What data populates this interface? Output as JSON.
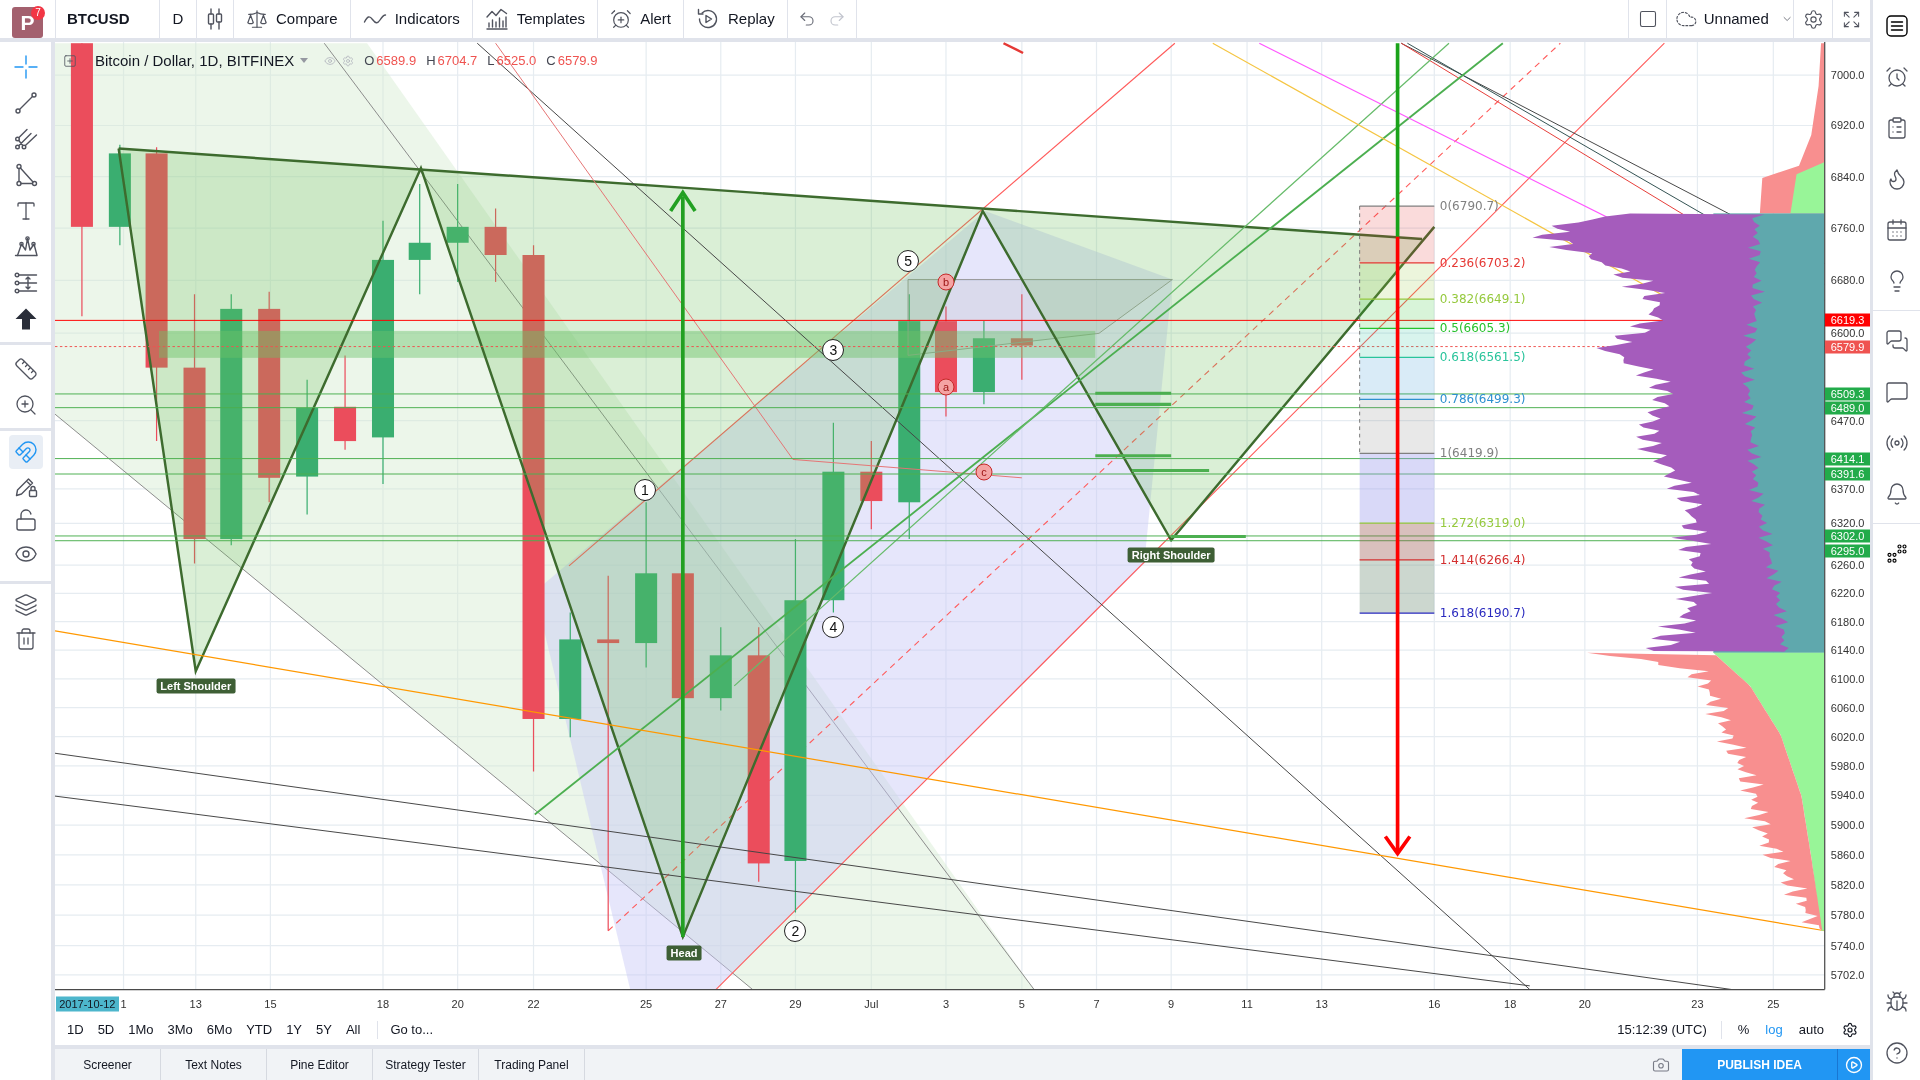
{
  "top_toolbar": {
    "logo": {
      "letter": "P",
      "badge": "7"
    },
    "symbol": "BTCUSD",
    "interval": "D",
    "buttons": [
      "Compare",
      "Indicators",
      "Templates",
      "Alert",
      "Replay"
    ],
    "undo": {
      "disabled": false
    },
    "redo": {
      "disabled": true
    },
    "layout_name": "Unnamed"
  },
  "drawing_toolbar": {
    "tools": [
      {
        "selected": true
      },
      {
        "selected": false
      },
      {
        "selected": false
      },
      {
        "selected": false
      },
      {
        "selected": false
      },
      {
        "selected": false
      },
      {
        "selected": false
      },
      {
        "selected": false
      },
      {
        "selected": false
      },
      {
        "selected": false
      }
    ],
    "toggles": [
      {
        "on": true
      },
      {
        "on": false
      },
      {
        "on": false
      },
      {
        "on": false
      }
    ]
  },
  "chart": {
    "legend": {
      "title": "Bitcoin / Dollar, 1D, BITFINEX",
      "values": [
        {
          "label": "O",
          "value": "6589.9"
        },
        {
          "label": "H",
          "value": "6704.7"
        },
        {
          "label": "L",
          "value": "6525.0"
        },
        {
          "label": "C",
          "value": "6579.9"
        }
      ]
    },
    "pattern_labels": [
      "Left Shoulder",
      "Head",
      "Right Shoulder"
    ],
    "wave_markers": [
      {
        "kind": "number",
        "text": "1"
      },
      {
        "kind": "number",
        "text": "2"
      },
      {
        "kind": "number",
        "text": "3"
      },
      {
        "kind": "number",
        "text": "4"
      },
      {
        "kind": "number",
        "text": "5"
      },
      {
        "kind": "letter",
        "text": "a"
      },
      {
        "kind": "letter",
        "text": "b"
      },
      {
        "kind": "letter",
        "text": "c"
      }
    ],
    "fib_levels": [
      {
        "label": "0(6790.7)",
        "color": "#808080"
      },
      {
        "label": "0.236(6703.2)",
        "color": "#e53935"
      },
      {
        "label": "0.382(6649.1)",
        "color": "#95c93d"
      },
      {
        "label": "0.5(6605.3)",
        "color": "#27c22c"
      },
      {
        "label": "0.618(6561.5)",
        "color": "#29c49b"
      },
      {
        "label": "0.786(6499.3)",
        "color": "#2e90d0"
      },
      {
        "label": "1(6419.9)",
        "color": "#808080"
      },
      {
        "label": "1.272(6319.0)",
        "color": "#95c93d"
      },
      {
        "label": "1.414(6266.4)",
        "color": "#d32f2f"
      },
      {
        "label": "1.618(6190.7)",
        "color": "#2a2abf"
      }
    ],
    "price_axis": {
      "ticks": [
        "7000.0",
        "6920.0",
        "6840.0",
        "6760.0",
        "6680.0",
        "6600.0",
        "6470.0",
        "6370.0",
        "6320.0",
        "6260.0",
        "6220.0",
        "6180.0",
        "6140.0",
        "6100.0",
        "6060.0",
        "6020.0",
        "5980.0",
        "5940.0",
        "5900.0",
        "5860.0",
        "5820.0",
        "5780.0",
        "5740.0",
        "5702.0"
      ],
      "tags": [
        {
          "text": "6619.3",
          "color": "#ff0000"
        },
        {
          "text": "6579.9",
          "color": "#ef5350"
        },
        {
          "text": "6509.3",
          "color": "#22ab4a"
        },
        {
          "text": "6489.0",
          "color": "#22ab4a"
        },
        {
          "text": "6414.1",
          "color": "#22ab4a"
        },
        {
          "text": "6391.6",
          "color": "#22ab4a"
        },
        {
          "text": "6302.0",
          "color": "#22ab4a"
        },
        {
          "text": "6295.0",
          "color": "#22ab4a"
        }
      ]
    },
    "time_axis": {
      "cursor_date": "2017-10-12",
      "ticks": [
        "1",
        "13",
        "15",
        "18",
        "20",
        "22",
        "25",
        "27",
        "29",
        "Jul",
        "3",
        "5",
        "7",
        "9",
        "11",
        "13",
        "16",
        "18",
        "20",
        "23",
        "25"
      ]
    }
  },
  "range_bar": {
    "ranges": [
      "1D",
      "5D",
      "1Mo",
      "3Mo",
      "6Mo",
      "YTD",
      "1Y",
      "5Y",
      "All"
    ],
    "goto": "Go to...",
    "clock": "15:12:39 (UTC)",
    "scale_modes": [
      {
        "label": "%",
        "selected": false
      },
      {
        "label": "log",
        "selected": true
      },
      {
        "label": "auto",
        "selected": false
      }
    ]
  },
  "bottom_panel": {
    "tabs": [
      "Screener",
      "Text Notes",
      "Pine Editor",
      "Strategy Tester",
      "Trading Panel"
    ],
    "publish_button": "PUBLISH IDEA"
  }
}
